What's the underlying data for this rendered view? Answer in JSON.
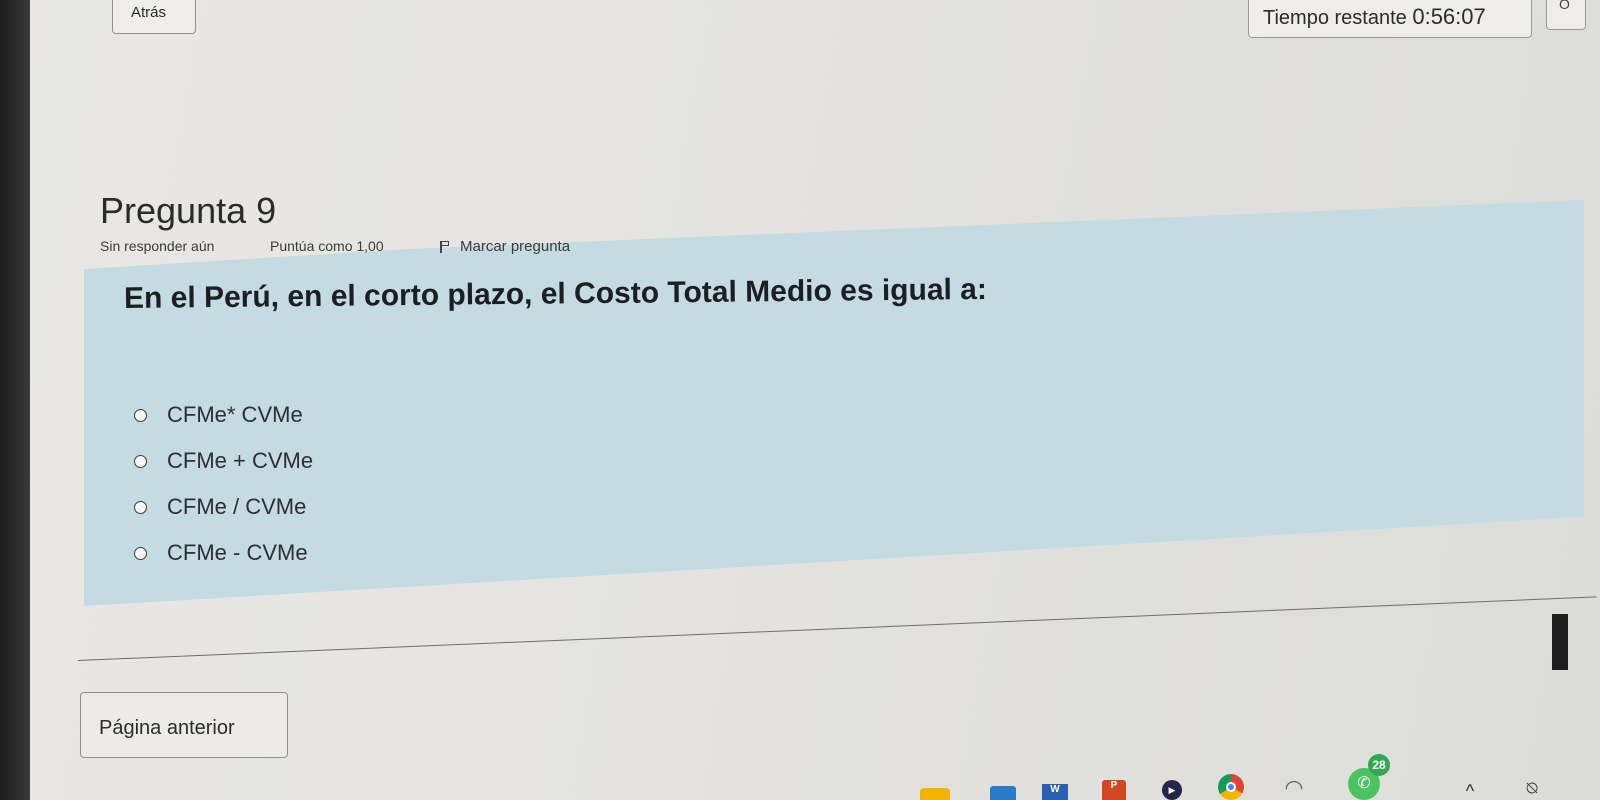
{
  "header": {
    "back_label": "Atrás",
    "timer_label": "Tiempo restante",
    "timer_value": "0:56:07",
    "extra_label": "O"
  },
  "question": {
    "title": "Pregunta 9",
    "status": "Sin responder aún",
    "points": "Puntúa como 1,00",
    "flag_label": "Marcar pregunta",
    "text": "En el Perú, en el corto plazo, el Costo Total Medio es igual a:",
    "options": [
      {
        "label": "CFMe* CVMe",
        "selected": false
      },
      {
        "label": "CFMe + CVMe",
        "selected": false
      },
      {
        "label": "CFMe / CVMe",
        "selected": false
      },
      {
        "label": "CFMe - CVMe",
        "selected": false
      }
    ]
  },
  "navigation": {
    "prev_page_label": "Página anterior"
  },
  "taskbar": {
    "icons": [
      "weather-icon",
      "store-icon",
      "word-icon",
      "powerpoint-icon",
      "media-player-icon",
      "chrome-icon",
      "wifi-icon",
      "whatsapp-icon",
      "chevron-up-icon",
      "notification-icon"
    ],
    "word_letter": "W",
    "ppt_letter": "P",
    "whatsapp_badge": "28"
  },
  "colors": {
    "question_panel": "#c4dbe2",
    "page_background": "#e6e5e1"
  }
}
